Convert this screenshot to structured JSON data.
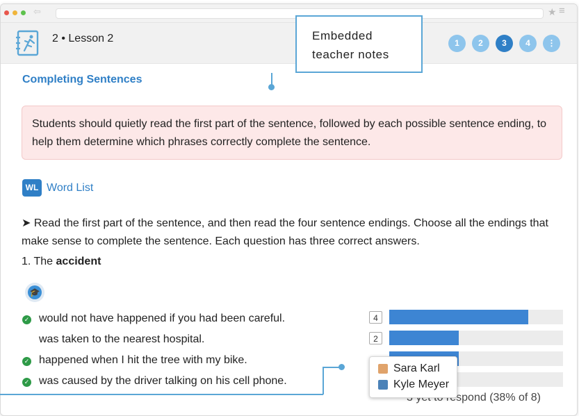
{
  "lesson": {
    "title": "2 • Lesson 2",
    "steps": [
      "1",
      "2",
      "3",
      "4",
      "⋮"
    ],
    "active_step": "3"
  },
  "callout": {
    "text": "Embedded teacher notes"
  },
  "section_title": "Completing Sentences",
  "teacher_note": "Students should quietly read the first part of the sentence, followed by each possible sentence ending, to help them determine which phrases correctly complete the sentence.",
  "word_list": {
    "badge": "WL",
    "label": "Word List"
  },
  "instructions": "➤ Read the first part of the sentence, and then read the four sentence endings. Choose all the endings that make sense to complete the sentence. Each question has three correct answers.",
  "question": {
    "prefix": "1. The ",
    "keyword": "accident"
  },
  "answers": [
    {
      "text": "would not have happened if you had been careful.",
      "correct": true,
      "count": "4",
      "fraction": 0.8
    },
    {
      "text": "was taken to the nearest hospital.",
      "correct": false,
      "count": "2",
      "fraction": 0.4
    },
    {
      "text": "happened when I hit the tree with my bike.",
      "correct": true,
      "count": "",
      "fraction": 0.4
    },
    {
      "text": "was caused by the driver talking on his cell phone.",
      "correct": true,
      "count": "",
      "fraction": 0.0
    }
  ],
  "tooltip": {
    "names": [
      "Sara Karl",
      "Kyle Meyer"
    ]
  },
  "response_summary": "3 yet to respond (38% of 8)",
  "colors": {
    "accent": "#2f7fc6",
    "bar": "#3d85d3",
    "note_bg": "#fde8e8",
    "check": "#2e9a47",
    "callout_border": "#5aa6d6"
  }
}
